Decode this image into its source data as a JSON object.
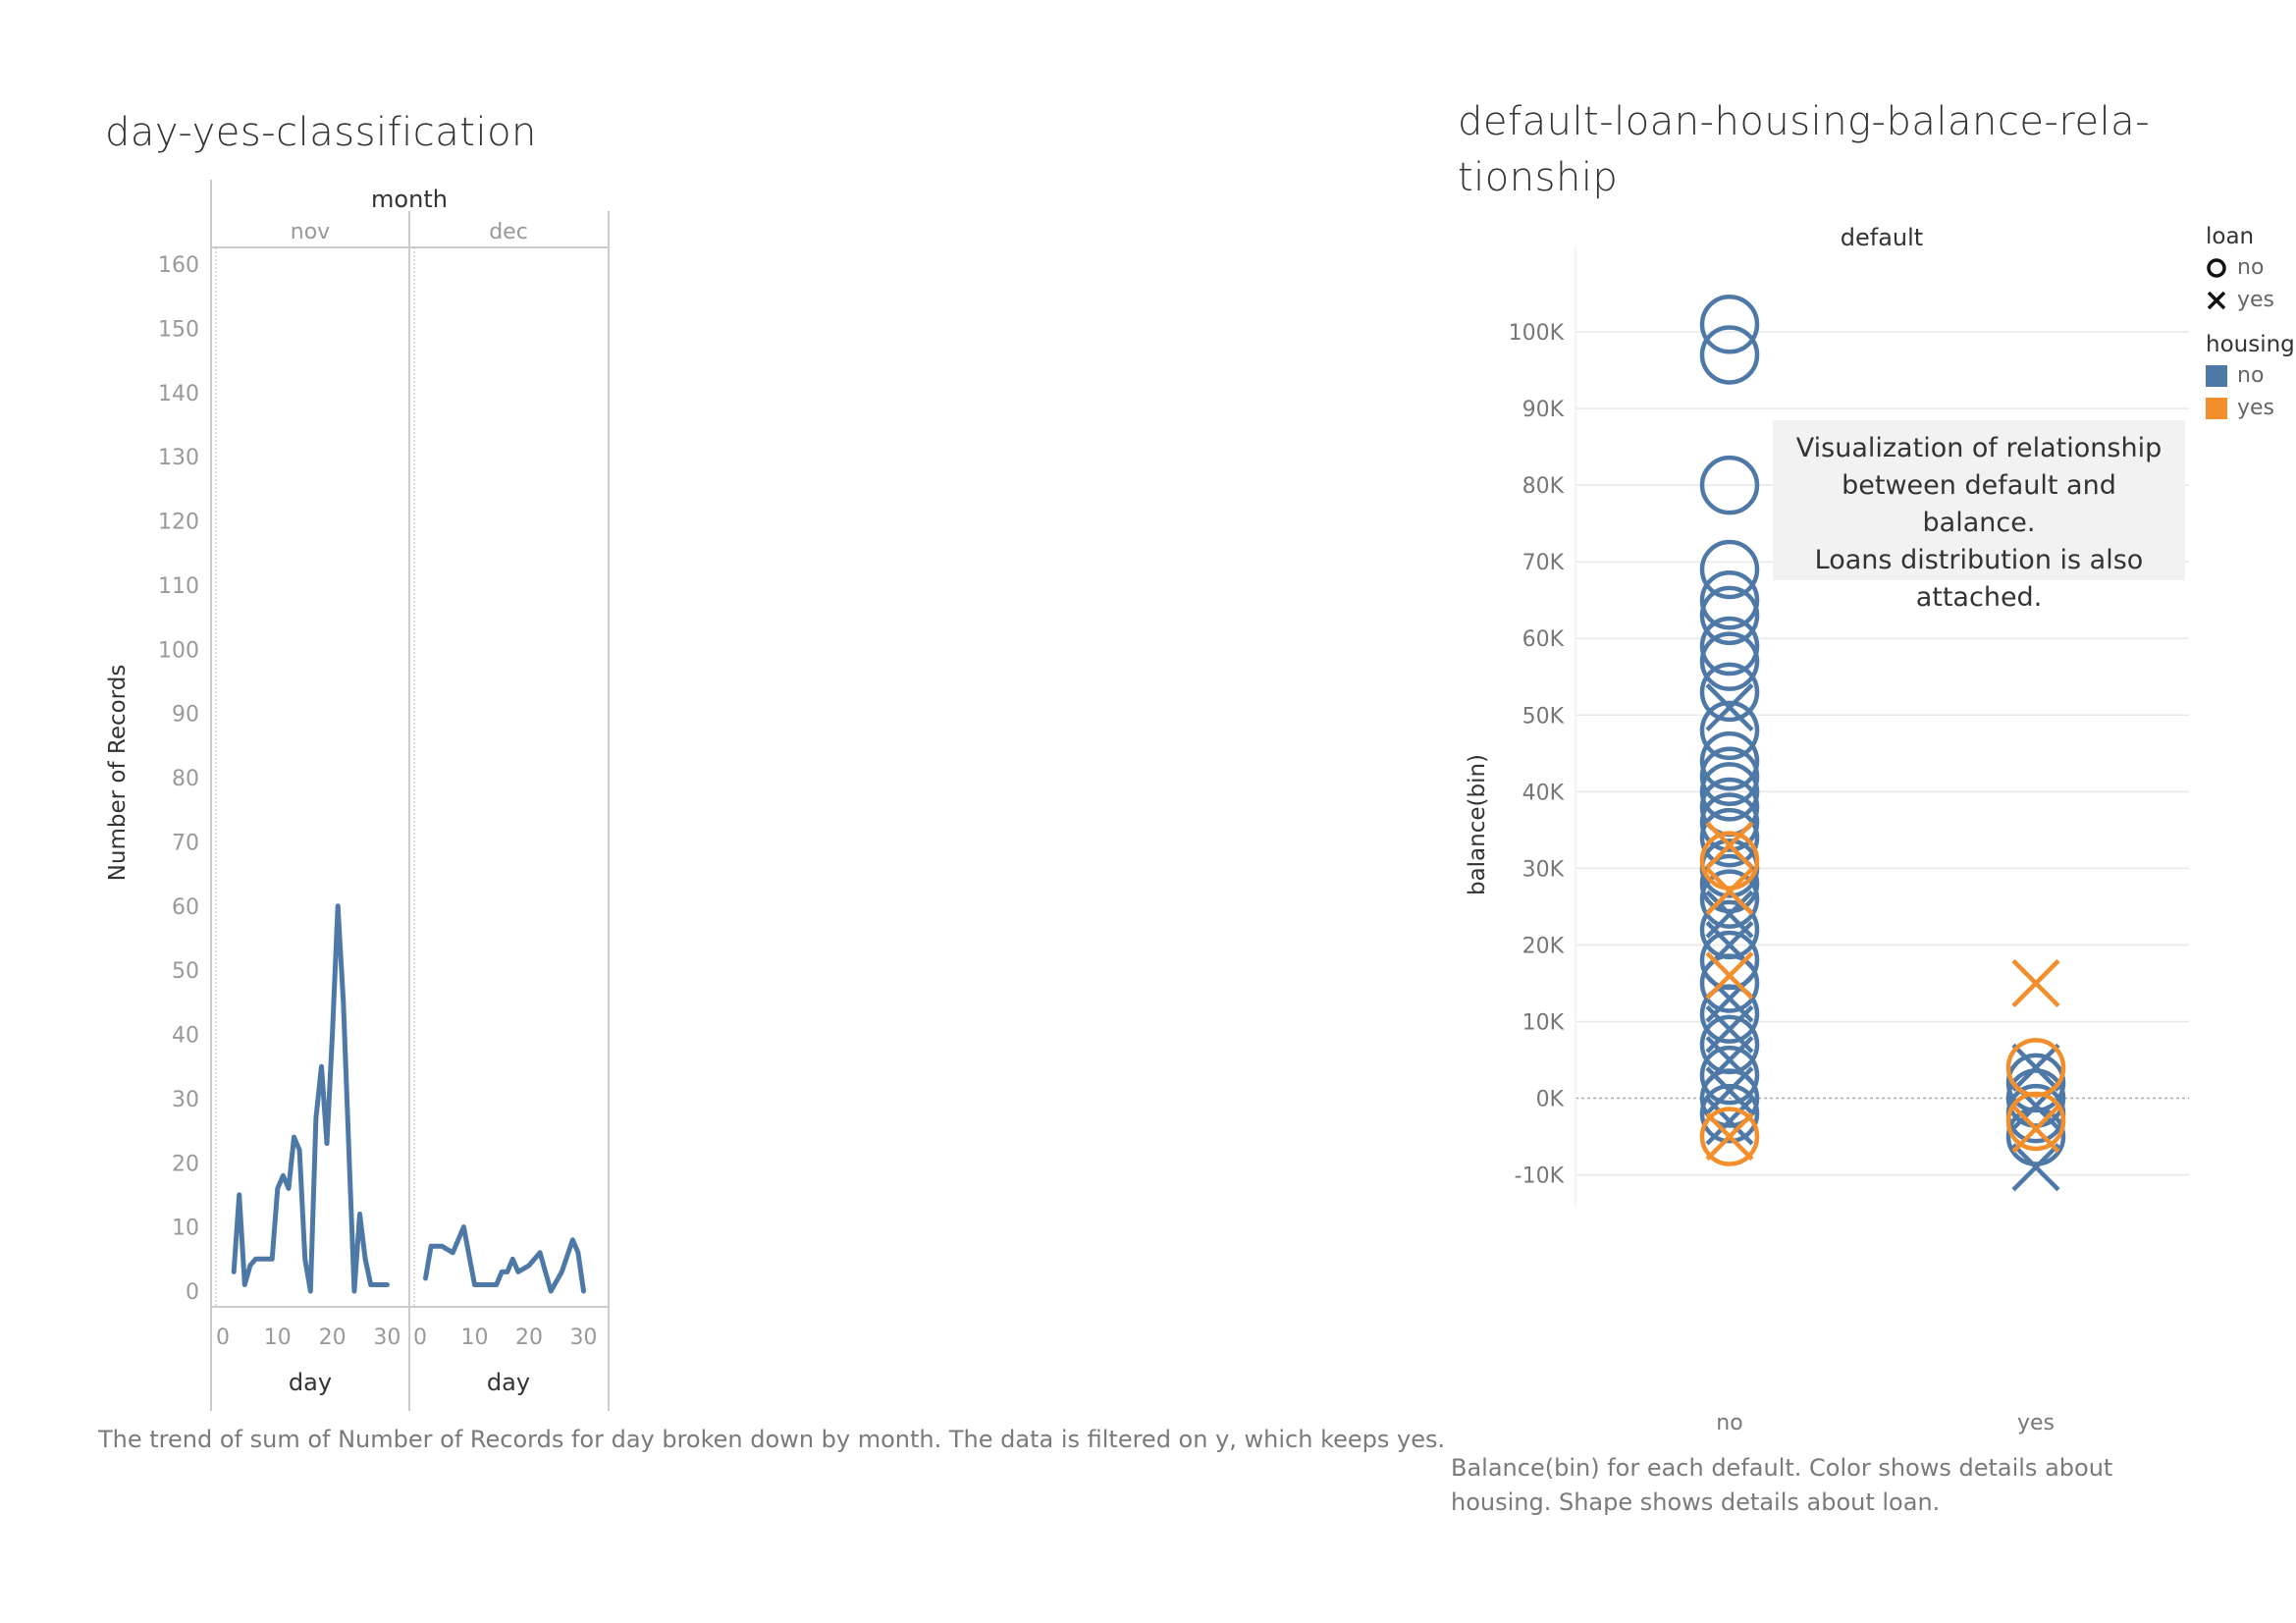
{
  "left_chart": {
    "title": "day-yes-classification",
    "caption": "The trend of sum of Number of Records for day broken down by month. The data is filtered on y, which keeps yes.",
    "column_header": "month",
    "ylabel": "Number of Records",
    "xlabel": "day"
  },
  "right_chart": {
    "title_line1": "default-loan-housing-balance-rela-",
    "title_line2": "tionship",
    "column_header": "default",
    "ylabel": "balance(bin)",
    "caption_line1": "Balance(bin) for each default.  Color shows details about",
    "caption_line2": "housing.  Shape shows details about loan.",
    "annotation": [
      "Visualization of relationship",
      "between default and balance.",
      "Loans distribution is also",
      "attached."
    ],
    "legend": {
      "loan_title": "loan",
      "loan_items": [
        {
          "label": "no",
          "icon": "circle-icon"
        },
        {
          "label": "yes",
          "icon": "cross-icon"
        }
      ],
      "housing_title": "housing",
      "housing_items": [
        {
          "label": "no",
          "color": "#4e79a7"
        },
        {
          "label": "yes",
          "color": "#f28e2b"
        }
      ]
    }
  },
  "colors": {
    "blue": "#4e79a7",
    "orange": "#f28e2b",
    "grid": "#e8e8e8",
    "axis": "#cccccc"
  },
  "chart_data": [
    {
      "type": "line",
      "title": "day-yes-classification",
      "xlabel": "day",
      "ylabel": "Number of Records",
      "facets": [
        "nov",
        "dec"
      ],
      "y_ticks": [
        0,
        10,
        20,
        30,
        40,
        50,
        60,
        70,
        80,
        90,
        100,
        110,
        120,
        130,
        140,
        150,
        160
      ],
      "x_ticks": [
        0,
        10,
        20,
        30
      ],
      "ylim": [
        0,
        160
      ],
      "xlim": [
        0,
        31
      ],
      "series": [
        {
          "facet": "nov",
          "x": [
            2,
            3,
            4,
            5,
            6,
            7,
            9,
            10,
            11,
            12,
            13,
            14,
            15,
            16,
            17,
            18,
            19,
            20,
            21,
            22,
            23,
            24,
            25,
            26,
            27,
            28,
            30
          ],
          "y": [
            3,
            15,
            1,
            4,
            5,
            5,
            5,
            16,
            18,
            16,
            24,
            22,
            5,
            0,
            27,
            35,
            23,
            40,
            60,
            45,
            22,
            0,
            12,
            5,
            1,
            1,
            1
          ]
        },
        {
          "facet": "dec",
          "x": [
            1,
            2,
            4,
            6,
            8,
            10,
            12,
            14,
            15,
            16,
            17,
            18,
            20,
            22,
            24,
            26,
            28,
            29,
            30
          ],
          "y": [
            2,
            7,
            7,
            6,
            10,
            1,
            1,
            1,
            3,
            3,
            5,
            3,
            4,
            6,
            0,
            3,
            8,
            6,
            0
          ]
        }
      ]
    },
    {
      "type": "scatter",
      "title": "default-loan-housing-balance-relationship",
      "xlabel": "default",
      "ylabel": "balance(bin)",
      "categories": [
        "no",
        "yes"
      ],
      "y_ticks": [
        -10000,
        0,
        10000,
        20000,
        30000,
        40000,
        50000,
        60000,
        70000,
        80000,
        90000,
        100000
      ],
      "y_tick_labels": [
        "-10K",
        "0K",
        "10K",
        "20K",
        "30K",
        "40K",
        "50K",
        "60K",
        "70K",
        "80K",
        "90K",
        "100K"
      ],
      "ylim": [
        -13000,
        110000
      ],
      "points": [
        {
          "default": "no",
          "balance": 101000,
          "loan": "no",
          "housing": "no"
        },
        {
          "default": "no",
          "balance": 97000,
          "loan": "no",
          "housing": "no"
        },
        {
          "default": "no",
          "balance": 80000,
          "loan": "no",
          "housing": "no"
        },
        {
          "default": "no",
          "balance": 69000,
          "loan": "no",
          "housing": "no"
        },
        {
          "default": "no",
          "balance": 65000,
          "loan": "no",
          "housing": "no"
        },
        {
          "default": "no",
          "balance": 63000,
          "loan": "no",
          "housing": "no"
        },
        {
          "default": "no",
          "balance": 59000,
          "loan": "no",
          "housing": "no"
        },
        {
          "default": "no",
          "balance": 57000,
          "loan": "no",
          "housing": "no"
        },
        {
          "default": "no",
          "balance": 53000,
          "loan": "no",
          "housing": "no"
        },
        {
          "default": "no",
          "balance": 51000,
          "loan": "yes",
          "housing": "no"
        },
        {
          "default": "no",
          "balance": 48000,
          "loan": "no",
          "housing": "no"
        },
        {
          "default": "no",
          "balance": 44000,
          "loan": "no",
          "housing": "no"
        },
        {
          "default": "no",
          "balance": 42000,
          "loan": "no",
          "housing": "no"
        },
        {
          "default": "no",
          "balance": 40000,
          "loan": "no",
          "housing": "no"
        },
        {
          "default": "no",
          "balance": 38000,
          "loan": "no",
          "housing": "no"
        },
        {
          "default": "no",
          "balance": 36000,
          "loan": "no",
          "housing": "no"
        },
        {
          "default": "no",
          "balance": 34000,
          "loan": "no",
          "housing": "no"
        },
        {
          "default": "no",
          "balance": 33000,
          "loan": "yes",
          "housing": "yes"
        },
        {
          "default": "no",
          "balance": 31000,
          "loan": "no",
          "housing": "yes"
        },
        {
          "default": "no",
          "balance": 30000,
          "loan": "no",
          "housing": "no"
        },
        {
          "default": "no",
          "balance": 28000,
          "loan": "no",
          "housing": "no"
        },
        {
          "default": "no",
          "balance": 27000,
          "loan": "yes",
          "housing": "yes"
        },
        {
          "default": "no",
          "balance": 26000,
          "loan": "no",
          "housing": "no"
        },
        {
          "default": "no",
          "balance": 24000,
          "loan": "yes",
          "housing": "no"
        },
        {
          "default": "no",
          "balance": 22000,
          "loan": "no",
          "housing": "no"
        },
        {
          "default": "no",
          "balance": 20000,
          "loan": "yes",
          "housing": "no"
        },
        {
          "default": "no",
          "balance": 18000,
          "loan": "no",
          "housing": "no"
        },
        {
          "default": "no",
          "balance": 16000,
          "loan": "yes",
          "housing": "yes"
        },
        {
          "default": "no",
          "balance": 15000,
          "loan": "no",
          "housing": "no"
        },
        {
          "default": "no",
          "balance": 13000,
          "loan": "yes",
          "housing": "no"
        },
        {
          "default": "no",
          "balance": 11000,
          "loan": "no",
          "housing": "no"
        },
        {
          "default": "no",
          "balance": 9000,
          "loan": "yes",
          "housing": "no"
        },
        {
          "default": "no",
          "balance": 7000,
          "loan": "no",
          "housing": "no"
        },
        {
          "default": "no",
          "balance": 5000,
          "loan": "yes",
          "housing": "no"
        },
        {
          "default": "no",
          "balance": 3000,
          "loan": "no",
          "housing": "no"
        },
        {
          "default": "no",
          "balance": 1000,
          "loan": "yes",
          "housing": "no"
        },
        {
          "default": "no",
          "balance": 0,
          "loan": "no",
          "housing": "no"
        },
        {
          "default": "no",
          "balance": -2000,
          "loan": "no",
          "housing": "no"
        },
        {
          "default": "no",
          "balance": -3000,
          "loan": "yes",
          "housing": "no"
        },
        {
          "default": "no",
          "balance": -5000,
          "loan": "no",
          "housing": "yes"
        },
        {
          "default": "no",
          "balance": -5000,
          "loan": "yes",
          "housing": "yes"
        },
        {
          "default": "yes",
          "balance": 15000,
          "loan": "yes",
          "housing": "yes"
        },
        {
          "default": "yes",
          "balance": 4000,
          "loan": "yes",
          "housing": "no"
        },
        {
          "default": "yes",
          "balance": 4000,
          "loan": "no",
          "housing": "yes"
        },
        {
          "default": "yes",
          "balance": 2000,
          "loan": "no",
          "housing": "no"
        },
        {
          "default": "yes",
          "balance": 0,
          "loan": "no",
          "housing": "no"
        },
        {
          "default": "yes",
          "balance": -1000,
          "loan": "yes",
          "housing": "no"
        },
        {
          "default": "yes",
          "balance": -2000,
          "loan": "no",
          "housing": "no"
        },
        {
          "default": "yes",
          "balance": -3000,
          "loan": "no",
          "housing": "yes"
        },
        {
          "default": "yes",
          "balance": -4000,
          "loan": "yes",
          "housing": "yes"
        },
        {
          "default": "yes",
          "balance": -5000,
          "loan": "no",
          "housing": "no"
        },
        {
          "default": "yes",
          "balance": -9000,
          "loan": "yes",
          "housing": "no"
        }
      ]
    }
  ]
}
